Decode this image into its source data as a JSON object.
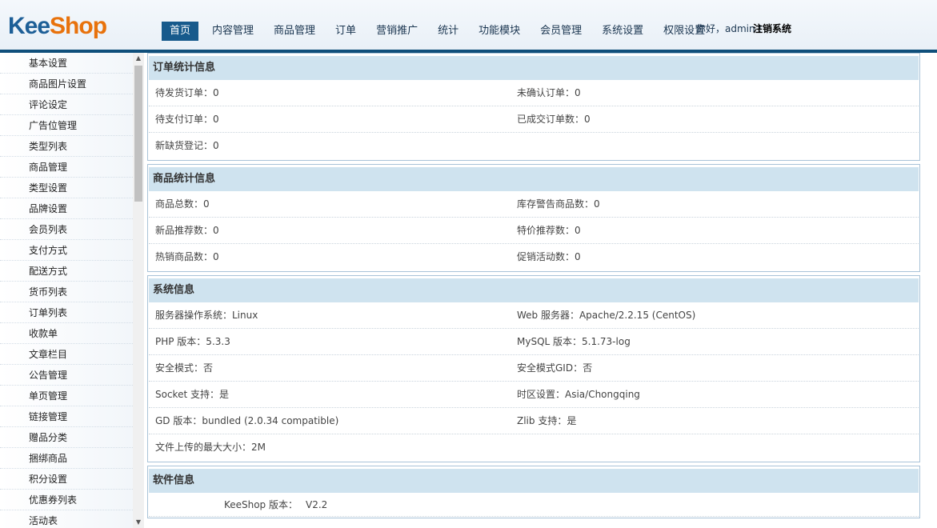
{
  "header": {
    "logo_part1": "Kee",
    "logo_part2": "Shop",
    "nav": [
      "首页",
      "内容管理",
      "商品管理",
      "订单",
      "营销推广",
      "统计",
      "功能模块",
      "会员管理",
      "系统设置",
      "权限设置"
    ],
    "welcome": "你好，admin !",
    "logout": "注销系统"
  },
  "sidebar": {
    "items": [
      "基本设置",
      "商品图片设置",
      "评论设定",
      "广告位管理",
      "类型列表",
      "商品管理",
      "类型设置",
      "品牌设置",
      "会员列表",
      "支付方式",
      "配送方式",
      "货币列表",
      "订单列表",
      "收款单",
      "文章栏目",
      "公告管理",
      "单页管理",
      "链接管理",
      "赠品分类",
      "捆绑商品",
      "积分设置",
      "优惠券列表",
      "活动表"
    ]
  },
  "order_stats": {
    "title": "订单统计信息",
    "rows": [
      [
        "待发货订单：0",
        "未确认订单：0"
      ],
      [
        "待支付订单：0",
        "已成交订单数：0"
      ],
      [
        "新缺货登记：0",
        ""
      ]
    ]
  },
  "goods_stats": {
    "title": "商品统计信息",
    "rows": [
      [
        "商品总数：0",
        "库存警告商品数：0"
      ],
      [
        "新品推荐数：0",
        "特价推荐数：0"
      ],
      [
        "热销商品数：0",
        "促销活动数：0"
      ]
    ]
  },
  "system_info": {
    "title": "系统信息",
    "rows": [
      [
        "服务器操作系统：Linux",
        "Web 服务器：Apache/2.2.15 (CentOS)"
      ],
      [
        "PHP 版本：5.3.3",
        "MySQL 版本：5.1.73-log"
      ],
      [
        "安全模式：否",
        "安全模式GID：否"
      ],
      [
        "Socket 支持：是",
        "时区设置：Asia/Chongqing"
      ],
      [
        "GD 版本：bundled (2.0.34 compatible)",
        "Zlib 支持：是"
      ],
      [
        "文件上传的最大大小：2M",
        ""
      ]
    ]
  },
  "software_info": {
    "title": "软件信息",
    "version_label": "KeeShop 版本：",
    "version_value": "V2.2"
  }
}
